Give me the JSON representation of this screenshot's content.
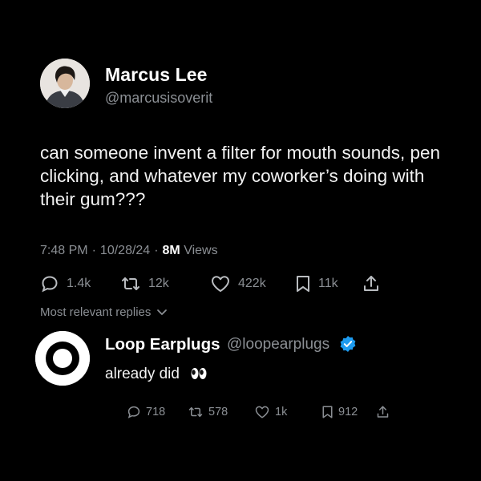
{
  "tweet": {
    "author_name": "Marcus Lee",
    "author_handle": "@marcusisoverit",
    "text": "can someone invent a filter for mouth sounds, pen clicking, and whatever my coworker’s doing with their gum???",
    "time": "7:48 PM",
    "date": "10/28/24",
    "views_count": "8M",
    "views_label": "Views",
    "stats": {
      "replies": "1.4k",
      "reposts": "12k",
      "likes": "422k",
      "bookmarks": "11k"
    }
  },
  "replies_filter": {
    "label": "Most relevant replies"
  },
  "reply": {
    "author_name": "Loop Earplugs",
    "author_handle": "@loopearplugs",
    "text": "already did",
    "emoji_icon": "eyes-emoji-icon",
    "stats": {
      "replies": "718",
      "reposts": "578",
      "likes": "1k",
      "bookmarks": "912"
    }
  },
  "colors": {
    "background": "#000000",
    "text": "#ffffff",
    "muted": "#8b8f94",
    "verified": "#1d9bf0"
  }
}
